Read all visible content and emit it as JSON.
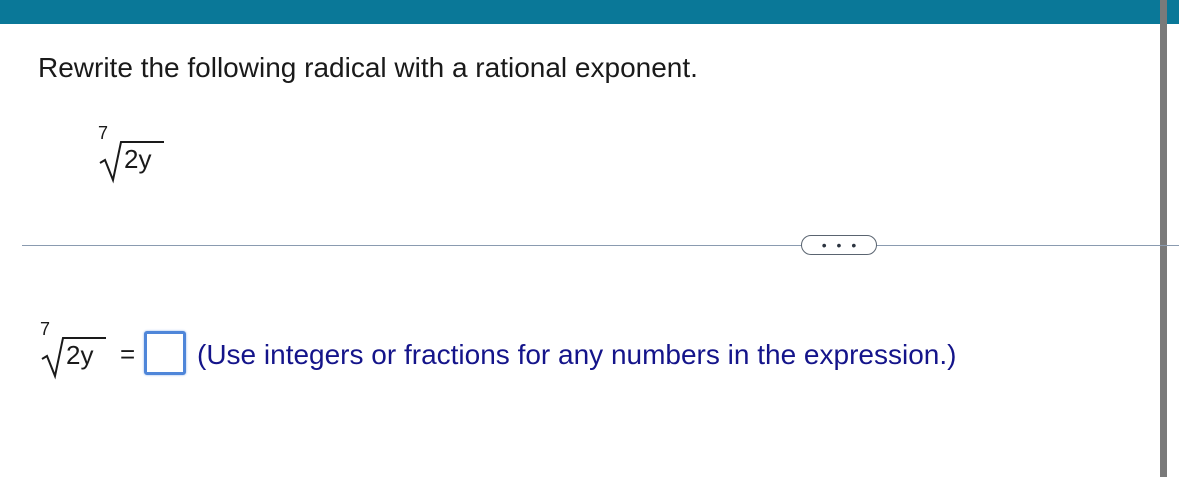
{
  "question": {
    "instruction": "Rewrite the following radical with a rational exponent.",
    "radical": {
      "index": "7",
      "radicand": "2y"
    }
  },
  "toolbar": {
    "more_label": "• • •"
  },
  "answer": {
    "lhs": {
      "index": "7",
      "radicand": "2y"
    },
    "equals": "=",
    "input_value": "",
    "hint": "(Use integers or fractions for any numbers in the expression.)"
  },
  "colors": {
    "topbar": "#0a7898",
    "hint_text": "#14148a",
    "input_border": "#4f86d9"
  }
}
